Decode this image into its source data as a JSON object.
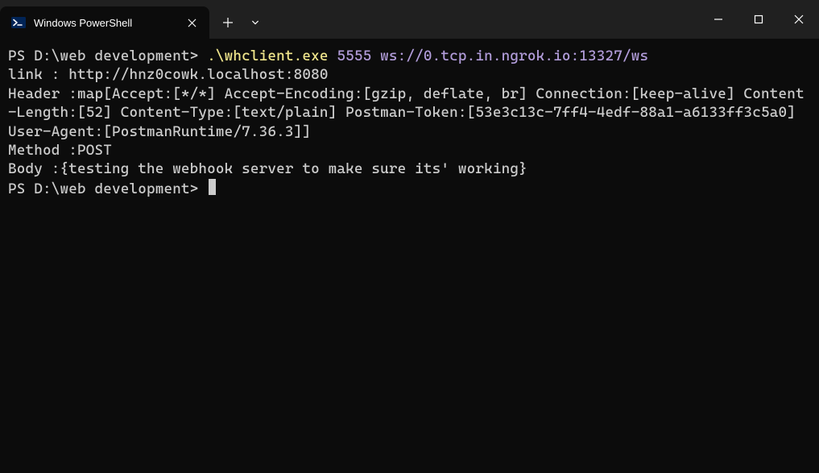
{
  "titlebar": {
    "tab_title": "Windows PowerShell"
  },
  "terminal": {
    "prompt1": "PS D:\\web development> ",
    "cmd_exe": ".\\whclient.exe",
    "cmd_arg1": " 5555",
    "cmd_arg2": " ws://0.tcp.in.ngrok.io:13327/ws",
    "line_link": "link : http://hnz0cowk.localhost:8080",
    "line_header": "Header :map[Accept:[*/*] Accept-Encoding:[gzip, deflate, br] Connection:[keep-alive] Content-Length:[52] Content-Type:[text/plain] Postman-Token:[53e3c13c-7ff4-4edf-88a1-a6133ff3c5a0] User-Agent:[PostmanRuntime/7.36.3]]",
    "line_method": "Method :POST",
    "line_body": "Body :{testing the webhook server to make sure its' working}",
    "prompt2": "PS D:\\web development> "
  }
}
